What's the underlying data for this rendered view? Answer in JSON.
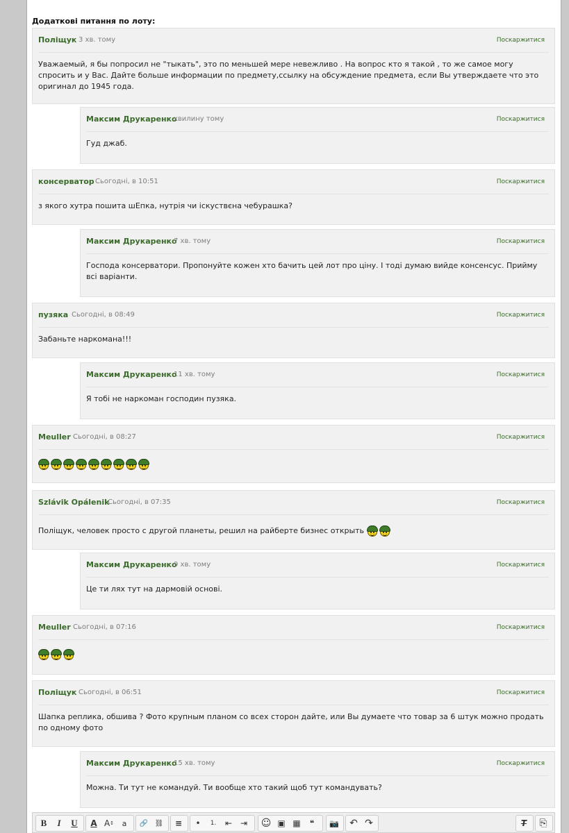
{
  "section_title": "Додаткові питання по лоту:",
  "report_label": "Поскаржитися",
  "comments": [
    {
      "author": "Поліщук",
      "date": "3 хв. тому",
      "text": "Уважаемый, я бы попросил не \"тыкать\", это по меньшей мере невежливо . На вопрос кто я такой , то же самое могу спросить и у Вас. Дайте больше информации по предмету,ссылку на обсуждение предмета, если Вы утверждаете что это оригинал до 1945 года."
    },
    {
      "author": "Максим Друкаренко",
      "date": "хвилину тому",
      "text": "Гуд джаб."
    },
    {
      "author": "консерватор",
      "date": "Сьогодні, в 10:51",
      "text": "з якого хутра пошита шЕпка, нутрія чи іскуствєна чебурашка?"
    },
    {
      "author": "Максим Друкаренко",
      "date": "7 хв. тому",
      "text": "Господа консерватори. Пропонуйте кожен хто бачить цей лот про ціну. І тоді думаю вийде консенсус. Прийму всі варіанти."
    },
    {
      "author": "пузяка",
      "date": "Сьогодні, в 08:49",
      "text": "Забаньте наркомана!!!"
    },
    {
      "author": "Максим Друкаренко",
      "date": "11 хв. тому",
      "text": "Я тобі не наркоман господин пузяка."
    },
    {
      "author": "Meuller",
      "date": "Сьогодні, в 08:27",
      "text": "",
      "smileys": 9
    },
    {
      "author": "Szlávik Opálenik",
      "date": "Сьогодні, в 07:35",
      "text": "Поліщук, человек просто с другой планеты, решил на райберте бизнес открыть",
      "smileys": 2
    },
    {
      "author": "Максим Друкаренко",
      "date": "9 хв. тому",
      "text": "Це ти лях тут на дармовій основі."
    },
    {
      "author": "Meuller",
      "date": "Сьогодні, в 07:16",
      "text": "",
      "smileys": 3
    },
    {
      "author": "Поліщук",
      "date": "Сьогодні, в 06:51",
      "text": "Шапка реплика, обшива ? Фото крупным планом со всех сторон дайте, или Вы думаете что товар за 6 штук можно продать по одному фото"
    },
    {
      "author": "Максим Друкаренко",
      "date": "15 хв. тому",
      "text": "Можна. Ти тут не командуй. Ти вообще хто такий щоб тут командувать?"
    }
  ],
  "toolbar": {
    "bold": "B",
    "italic": "I",
    "underline": "U",
    "font_color": "A",
    "font_size": "A",
    "font_size_sup": "↕",
    "font_family": "a",
    "link": "🔗",
    "unlink": "⛓",
    "align": "≡",
    "bullets": "•",
    "numbers": "1.",
    "outdent": "⇤",
    "indent": "⇥",
    "smiley": "☺",
    "image": "▣",
    "media": "▦",
    "quote": "❝",
    "camera": "📷",
    "undo": "↶",
    "redo": "↷",
    "clear_format": "T",
    "preview": "⎘"
  },
  "colors": {
    "author": "#3a6b2a",
    "card": "#f1f1f1",
    "smiley_helmet": "#3f7d2b",
    "smiley_face": "#f2d51f"
  }
}
